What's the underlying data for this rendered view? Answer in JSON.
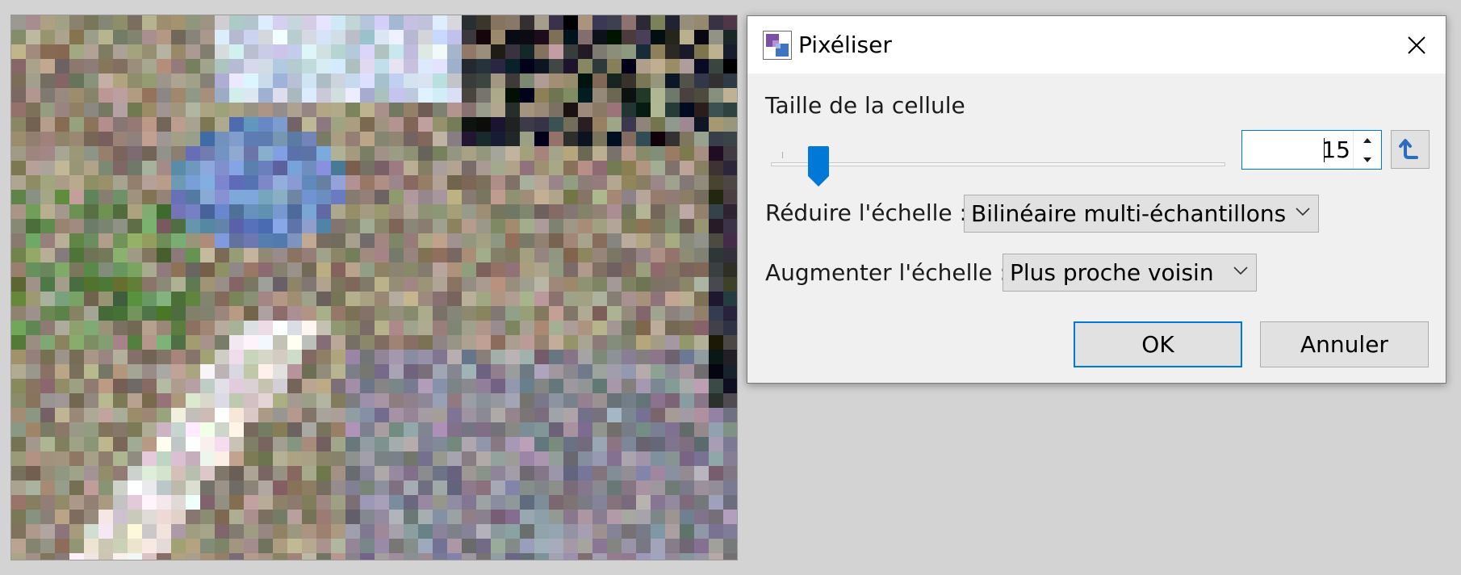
{
  "dialog": {
    "title": "Pixéliser",
    "cell_size": {
      "label": "Taille de la cellule",
      "value": "15",
      "slider_fraction": 0.07
    },
    "downscale": {
      "label": "Réduire l'échelle :",
      "selected": "Bilinéaire multi-échantillons"
    },
    "upscale": {
      "label": "Augmenter l'échelle :",
      "selected": "Plus proche voisin"
    },
    "ok_label": "OK",
    "cancel_label": "Annuler"
  },
  "colors": {
    "accent": "#0078d7",
    "dialog_bg": "#f0f0f0",
    "button_bg": "#e1e1e1",
    "workspace_bg": "#d3d3d3"
  },
  "icons": {
    "app": "pixelate-app-icon",
    "close": "close-icon",
    "spin_up": "spin-up-icon",
    "spin_down": "spin-down-icon",
    "reset": "reset-icon",
    "dropdown": "chevron-down-icon"
  }
}
